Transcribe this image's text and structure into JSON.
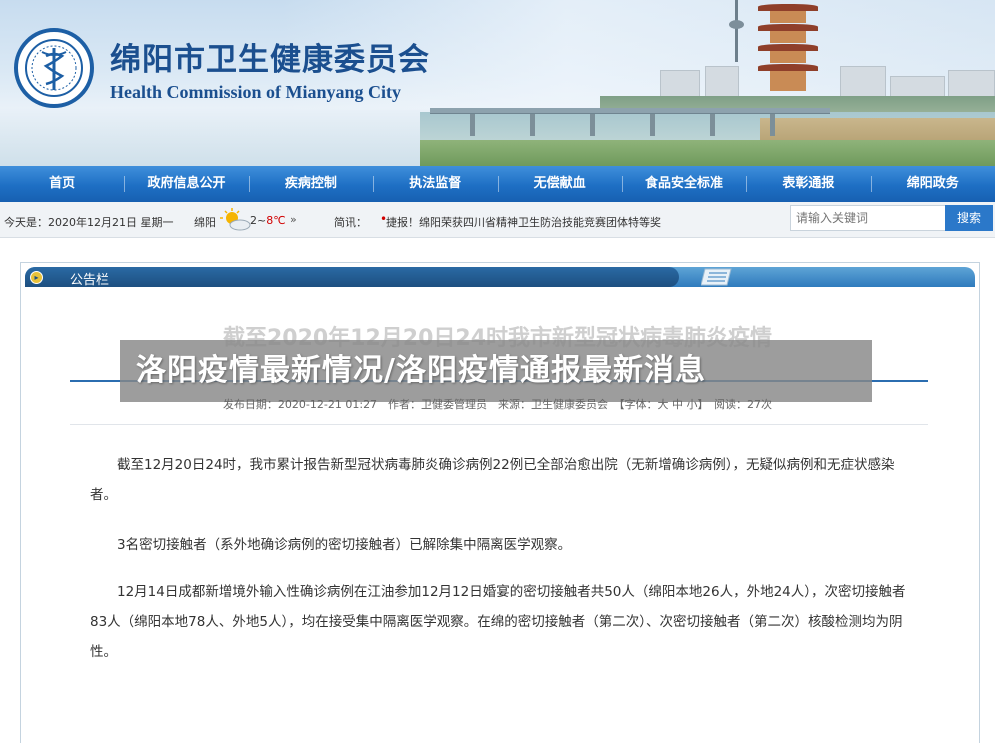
{
  "header": {
    "title_cn": "绵阳市卫生健康委员会",
    "title_en": "Health Commission of Mianyang City",
    "logo_icon": "caduceus-emblem-icon"
  },
  "nav": {
    "items": [
      "首页",
      "政府信息公开",
      "疾病控制",
      "执法监督",
      "无偿献血",
      "食品安全标准",
      "表彰通报",
      "绵阳政务"
    ]
  },
  "infobar": {
    "today": "今天是：2020年12月21日 星期一",
    "city": "绵阳",
    "temp_low": "2",
    "temp_sep": "~",
    "temp_high": "8℃",
    "more": "»",
    "brief_label": "简讯：",
    "brief_dot": "•",
    "brief_text": "捷报！绵阳荣获四川省精神卫生防治技能竞赛团体特等奖",
    "search_placeholder": "请输入关键词",
    "search_button": "搜索"
  },
  "panel": {
    "title": "公告栏"
  },
  "article": {
    "ghost_title": "截至2020年12月20日24时我市新型冠状病毒肺炎疫情",
    "overlay_title": "洛阳疫情最新情况/洛阳疫情通报最新消息",
    "meta": "发布日期：2020-12-21 01:27　作者：卫健委管理员　来源：卫生健康委员会　【字体：大 中 小】　阅读：27次",
    "paragraphs": [
      "截至12月20日24时，我市累计报告新型冠状病毒肺炎确诊病例22例已全部治愈出院（无新增确诊病例），无疑似病例和无症状感染者。",
      "3名密切接触者（系外地确诊病例的密切接触者）已解除集中隔离医学观察。",
      "12月14日成都新增境外输入性确诊病例在江油参加12月12日婚宴的密切接触者共50人（绵阳本地26人，外地24人），次密切接触者83人（绵阳本地78人、外地5人），均在接受集中隔离医学观察。在绵的密切接触者（第二次）、次密切接触者（第二次）核酸检测均为阴性。"
    ]
  },
  "colors": {
    "brand_blue": "#1b4f8f",
    "nav_blue": "#1e6fc4",
    "temp_red": "#d10000"
  }
}
